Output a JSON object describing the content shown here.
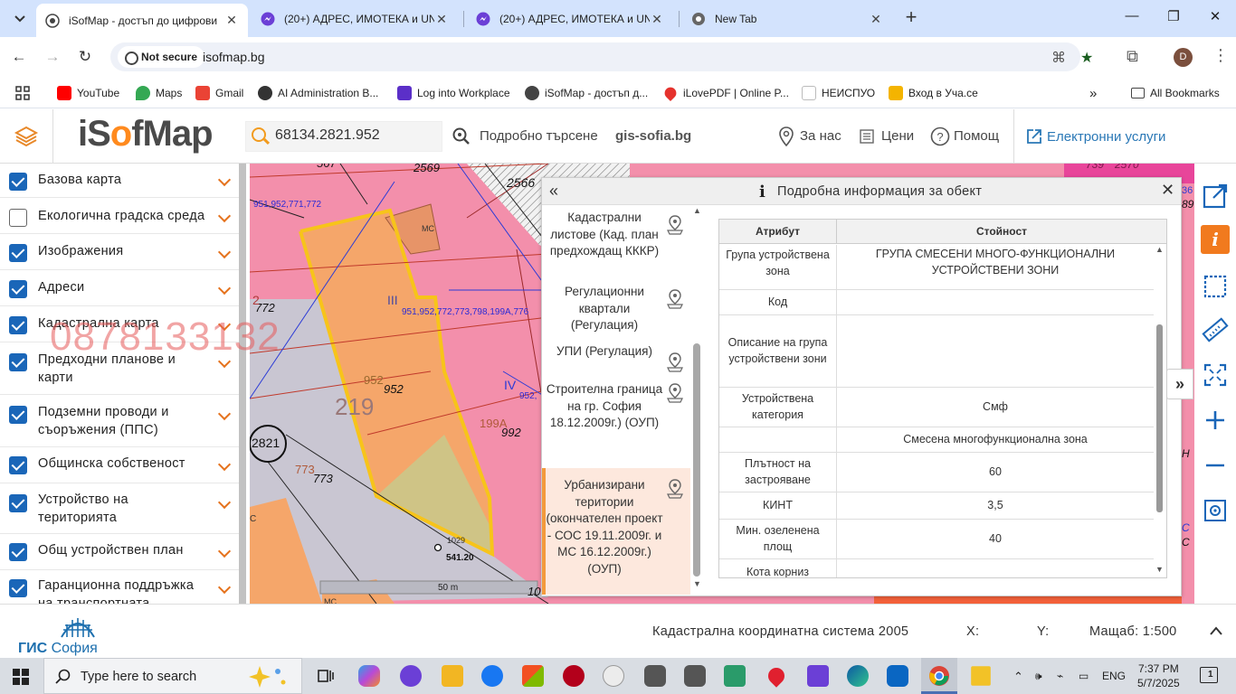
{
  "browser": {
    "tabs": [
      {
        "title": "iSofMap - достъп до цифрови",
        "active": true
      },
      {
        "title": "(20+) АДРЕС, ИМОТЕКА и UNI",
        "active": false
      },
      {
        "title": "(20+) АДРЕС, ИМОТЕКА и UNI",
        "active": false
      },
      {
        "title": "New Tab",
        "active": false
      }
    ],
    "security_label": "Not secure",
    "url": "isofmap.bg",
    "profile_initial": "D",
    "bookmarks": [
      {
        "label": "YouTube",
        "color": "#ff0000"
      },
      {
        "label": "Maps",
        "color": "#34a853"
      },
      {
        "label": "Gmail",
        "color": "#ea4335"
      },
      {
        "label": "AI Administration B...",
        "color": "#333333"
      },
      {
        "label": "Log into Workplace",
        "color": "#5b2fc8"
      },
      {
        "label": "iSofMap - достъп д...",
        "color": "#444444"
      },
      {
        "label": "iLovePDF | Online P...",
        "color": "#e5322d"
      },
      {
        "label": "НЕИСПУО",
        "color": "#ffffff"
      },
      {
        "label": "Вход в Уча.се",
        "color": "#f4b400"
      }
    ],
    "all_bookmarks": "All Bookmarks"
  },
  "header": {
    "logo_prefix": "iS",
    "logo_o": "o",
    "logo_suffix": "fMap",
    "search_value": "68134.2821.952",
    "advanced_search": "Подробно търсене",
    "gis_link": "gis-sofia.bg",
    "about": "За нас",
    "prices": "Цени",
    "help": "Помощ",
    "eservices": "Електронни услуги"
  },
  "layers": [
    {
      "label": "Базова карта",
      "checked": true
    },
    {
      "label": "Екологична градска среда",
      "checked": false
    },
    {
      "label": "Изображения",
      "checked": true
    },
    {
      "label": "Адреси",
      "checked": true
    },
    {
      "label": "Кадастрална карта",
      "checked": true
    },
    {
      "label": "Предходни планове и карти",
      "checked": true
    },
    {
      "label": "Подземни проводи и съоръжения (ППС)",
      "checked": true
    },
    {
      "label": "Общинска собственост",
      "checked": true
    },
    {
      "label": "Устройство на територията",
      "checked": true
    },
    {
      "label": "Общ устройствен план",
      "checked": true
    },
    {
      "label": "Гаранционна поддръжка на транспортната",
      "checked": true
    }
  ],
  "map": {
    "watermark": "0878133132",
    "labels": {
      "l2569": "2569",
      "l2566": "2566",
      "l567": "567",
      "l951": "951,952,771,772",
      "lmc1": "МС",
      "lIII": "III",
      "l951b": "951,952,772,773,798,199А,776",
      "l772": "772",
      "l2": "2",
      "l952a": "952",
      "l952b": "952",
      "l219": "219",
      "lIV": "IV",
      "l952c": "952,",
      "l199A": "199А",
      "l992": "992",
      "l2821": "2821",
      "l773a": "773",
      "l773b": "773",
      "l1029": "1029",
      "l541": "541.20",
      "l50m": "50 m",
      "l10": "10",
      "lmc2": "МС",
      "lC": "С",
      "l739": "739",
      "l2570": "2570",
      "l36": "36",
      "l89": "89",
      "lC2": "С",
      "lC3": "С",
      "lH": "Н"
    }
  },
  "popup": {
    "title": "Подробна информация за обект",
    "list": [
      {
        "label": "Кадастрални листове (Кад. план предхождащ КККР)",
        "selected": false
      },
      {
        "label": "Регулационни квартали (Регулация)",
        "selected": false
      },
      {
        "label": "УПИ (Регулация)",
        "selected": false
      },
      {
        "label": "Строителна граница на гр. София 18.12.2009г.) (ОУП)",
        "selected": false
      },
      {
        "label": "Урбанизирани територии (окончателен проект - СОС 19.11.2009г. и МС 16.12.2009г.) (ОУП)",
        "selected": true
      }
    ],
    "table_headers": {
      "attr": "Атрибут",
      "value": "Стойност"
    },
    "rows": [
      {
        "attr": "Група устройствена зона",
        "value": "ГРУПА СМЕСЕНИ МНОГО-ФУНКЦИОНАЛНИ УСТРОЙСТВЕНИ ЗОНИ"
      },
      {
        "attr": "Код",
        "value": ""
      },
      {
        "attr": "Описание на група устройствени зони",
        "value": ""
      },
      {
        "attr": "Устройствена категория",
        "value": "Смф"
      },
      {
        "attr": "",
        "value": "Смесена многофункционална зона"
      },
      {
        "attr": "Плътност на застрояване",
        "value": "60"
      },
      {
        "attr": "КИНТ",
        "value": "3,5"
      },
      {
        "attr": "Мин. озеленена площ",
        "value": "40"
      },
      {
        "attr": "Кота корниз",
        "value": ""
      }
    ]
  },
  "footer": {
    "gis_logo_a": "ГИС",
    "gis_logo_b": "София",
    "crs": "Кадастрална координатна система 2005",
    "x_label": "X:",
    "y_label": "Y:",
    "scale": "Мащаб: 1:500"
  },
  "taskbar": {
    "search_placeholder": "Type here to search",
    "lang": "ENG",
    "time": "7:37 PM",
    "date": "5/7/2025",
    "notif_count": "1"
  },
  "colors": {
    "accent_orange": "#f39a3c",
    "brand_blue": "#1a66b8",
    "map_pink": "#f38fab",
    "parcel_orange": "#f5a66a",
    "outline_yellow": "#f7c41a"
  }
}
